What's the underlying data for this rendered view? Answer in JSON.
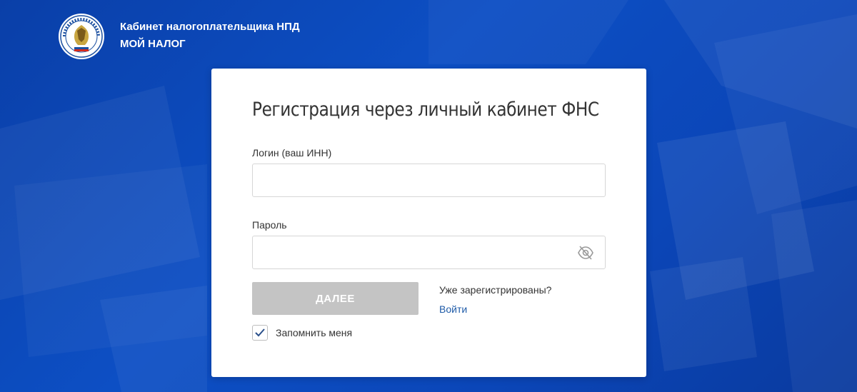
{
  "header": {
    "title": "Кабинет налогоплательщика НПД",
    "subtitle": "МОЙ НАЛОГ"
  },
  "form": {
    "title": "Регистрация через личный кабинет ФНС",
    "login_label": "Логин (ваш ИНН)",
    "login_value": "",
    "password_label": "Пароль",
    "password_value": "",
    "submit_label": "ДАЛЕЕ",
    "already_registered": "Уже зарегистрированы?",
    "login_link": "Войти",
    "remember_label": "Запомнить меня",
    "remember_checked": true
  },
  "colors": {
    "background": "#0d4fc4",
    "button_disabled": "#c4c4c4",
    "link": "#1f5ba8",
    "check": "#2a4f8a"
  },
  "icons": {
    "password_toggle": "eye-slash-icon",
    "checkbox_mark": "check-icon",
    "logo": "fns-emblem"
  }
}
